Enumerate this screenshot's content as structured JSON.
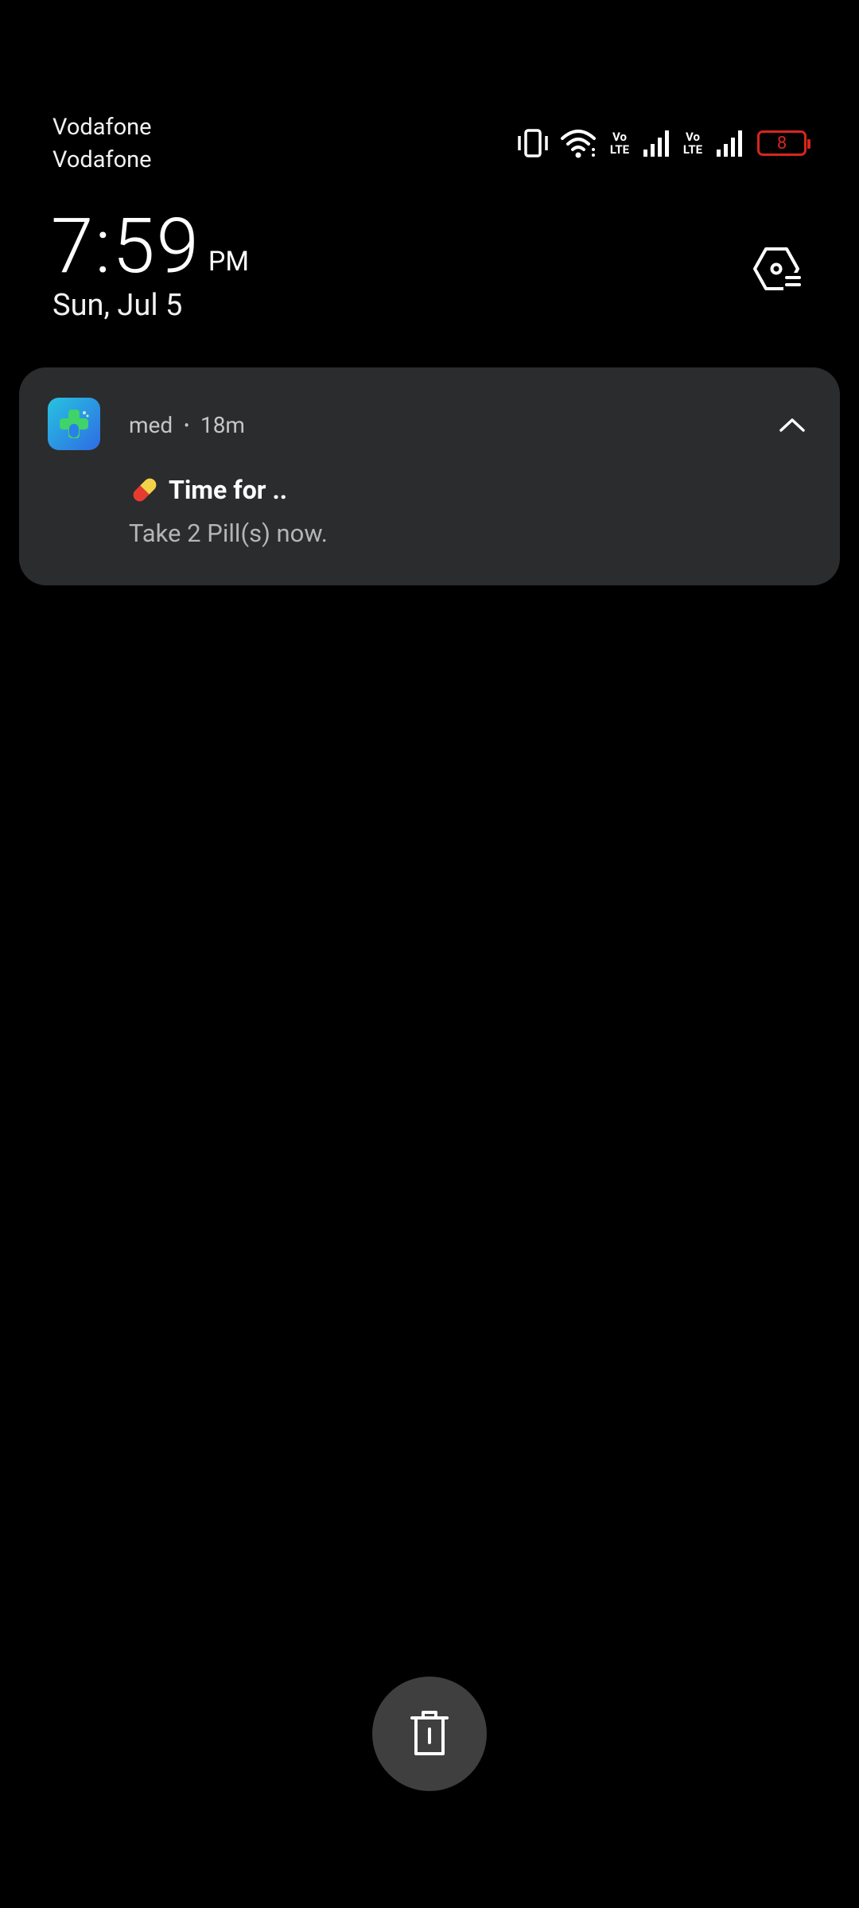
{
  "status_bar": {
    "carrier_1": "Vodafone",
    "carrier_2": "Vodafone",
    "volte_1_top": "Vo",
    "volte_1_bottom": "LTE",
    "volte_2_top": "Vo",
    "volte_2_bottom": "LTE",
    "battery_level": "8",
    "icons": [
      "vibrate-icon",
      "wifi-icon",
      "volte-icon",
      "signal-icon",
      "volte-icon",
      "signal-icon",
      "battery-icon"
    ]
  },
  "lockscreen": {
    "time": "7:59",
    "ampm": "PM",
    "date": "Sun, Jul 5"
  },
  "notification": {
    "app_name": "med",
    "separator": "•",
    "age": "18m",
    "title": "Time for ..",
    "body": "Take 2 Pill(s) now."
  },
  "colors": {
    "background": "#000000",
    "card": "#2b2c2e",
    "battery_low": "#d7261e",
    "clear_button": "#3f3f3f"
  }
}
